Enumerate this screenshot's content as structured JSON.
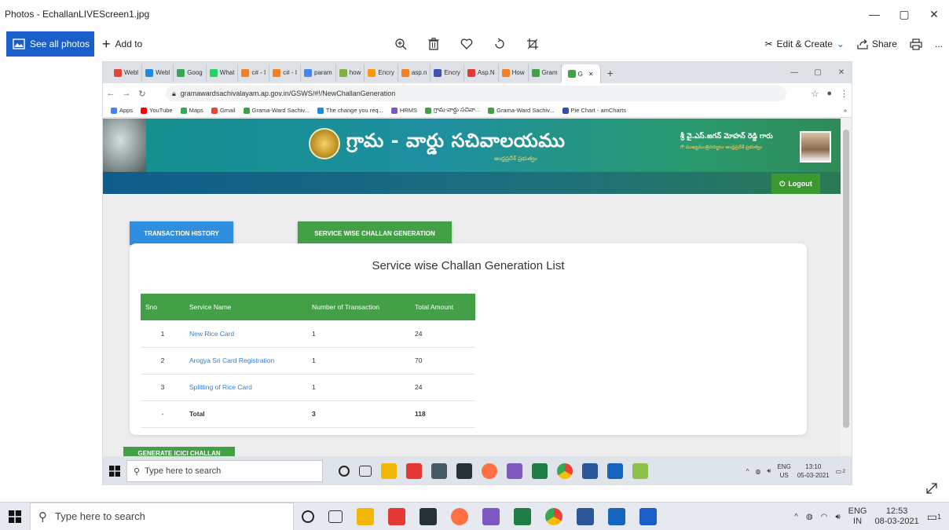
{
  "window": {
    "title": "Photos - EchallanLIVEScreen1.jpg",
    "controls": [
      "—",
      "▢",
      "✕"
    ]
  },
  "photos_toolbar": {
    "see_all": "See all photos",
    "add_to": "Add to",
    "edit_create": "Edit & Create",
    "share": "Share",
    "more": "..."
  },
  "browser": {
    "tabs": [
      {
        "label": "Webl",
        "color": "#ea4335"
      },
      {
        "label": "Webl",
        "color": "#1e88e5"
      },
      {
        "label": "Goog",
        "color": "#34a853"
      },
      {
        "label": "What",
        "color": "#25d366"
      },
      {
        "label": "c# - I",
        "color": "#f48024"
      },
      {
        "label": "c# - I",
        "color": "#f48024"
      },
      {
        "label": "param",
        "color": "#4285f4"
      },
      {
        "label": "how",
        "color": "#7cb342"
      },
      {
        "label": "Encry",
        "color": "#ff9800"
      },
      {
        "label": "asp.n",
        "color": "#f48024"
      },
      {
        "label": "Encry",
        "color": "#3f51b5"
      },
      {
        "label": "Asp.N",
        "color": "#e53935"
      },
      {
        "label": "How",
        "color": "#f48024"
      },
      {
        "label": "Gram",
        "color": "#43a047"
      },
      {
        "label": "G",
        "color": "#43a047",
        "active": true
      }
    ],
    "new_tab": "+",
    "url": "gramawardsachivalayam.ap.gov.in/GSWS/#!/NewChallanGeneration",
    "bookmarks": [
      {
        "label": "Apps",
        "color": "#4285f4"
      },
      {
        "label": "YouTube",
        "color": "#ff0000"
      },
      {
        "label": "Maps",
        "color": "#34a853"
      },
      {
        "label": "Gmail",
        "color": "#ea4335"
      },
      {
        "label": "Grama-Ward Sachiv...",
        "color": "#43a047"
      },
      {
        "label": "The change you req...",
        "color": "#1e88e5"
      },
      {
        "label": "HRMS",
        "color": "#7e57c2"
      },
      {
        "label": "గ్రామ-వార్డు సచివా...",
        "color": "#43a047"
      },
      {
        "label": "Grama-Ward Sachiv...",
        "color": "#43a047"
      },
      {
        "label": "Pie Chart - amCharts",
        "color": "#3949ab"
      }
    ],
    "more_bookmarks": "»"
  },
  "portal": {
    "title": "గ్రామ - వార్డు సచివాలయము",
    "subtitle": "ఆంధ్రప్రదేశ్ ప్రభుత్వం",
    "cm_name": "శ్రీ వై.ఎస్.జగన్ మోహన్ రెడ్డి గారు",
    "cm_role": "గౌ ముఖ్యమంత్రివర్యులు ఆంధ్రప్రదేశ్ ప్రభుత్వం",
    "logout": "Logout",
    "tab_history": "TRANSACTION HISTORY",
    "tab_service": "SERVICE WISE CHALLAN GENERATION",
    "list_title": "Service wise Challan Generation List",
    "table": {
      "headers": [
        "Sno",
        "Service Name",
        "Number of Transaction",
        "Total Amount"
      ],
      "rows": [
        [
          "1",
          "New Rice Card",
          "1",
          "24"
        ],
        [
          "2",
          "Arogya Sri Card Registration",
          "1",
          "70"
        ],
        [
          "3",
          "Splitting of Rice Card",
          "1",
          "24"
        ],
        [
          "-",
          "Total",
          "3",
          "118"
        ]
      ]
    },
    "generate_button": "GENERATE ICICI CHALLAN"
  },
  "inner_taskbar": {
    "search_placeholder": "Type here to search",
    "lang": "ENG",
    "region": "US",
    "time": "13:10",
    "date": "05-03-2021",
    "notifications": "2"
  },
  "taskbar": {
    "search_placeholder": "Type here to search",
    "lang": "ENG",
    "region": "IN",
    "time": "12:53",
    "date": "08-03-2021",
    "notifications": "1"
  }
}
